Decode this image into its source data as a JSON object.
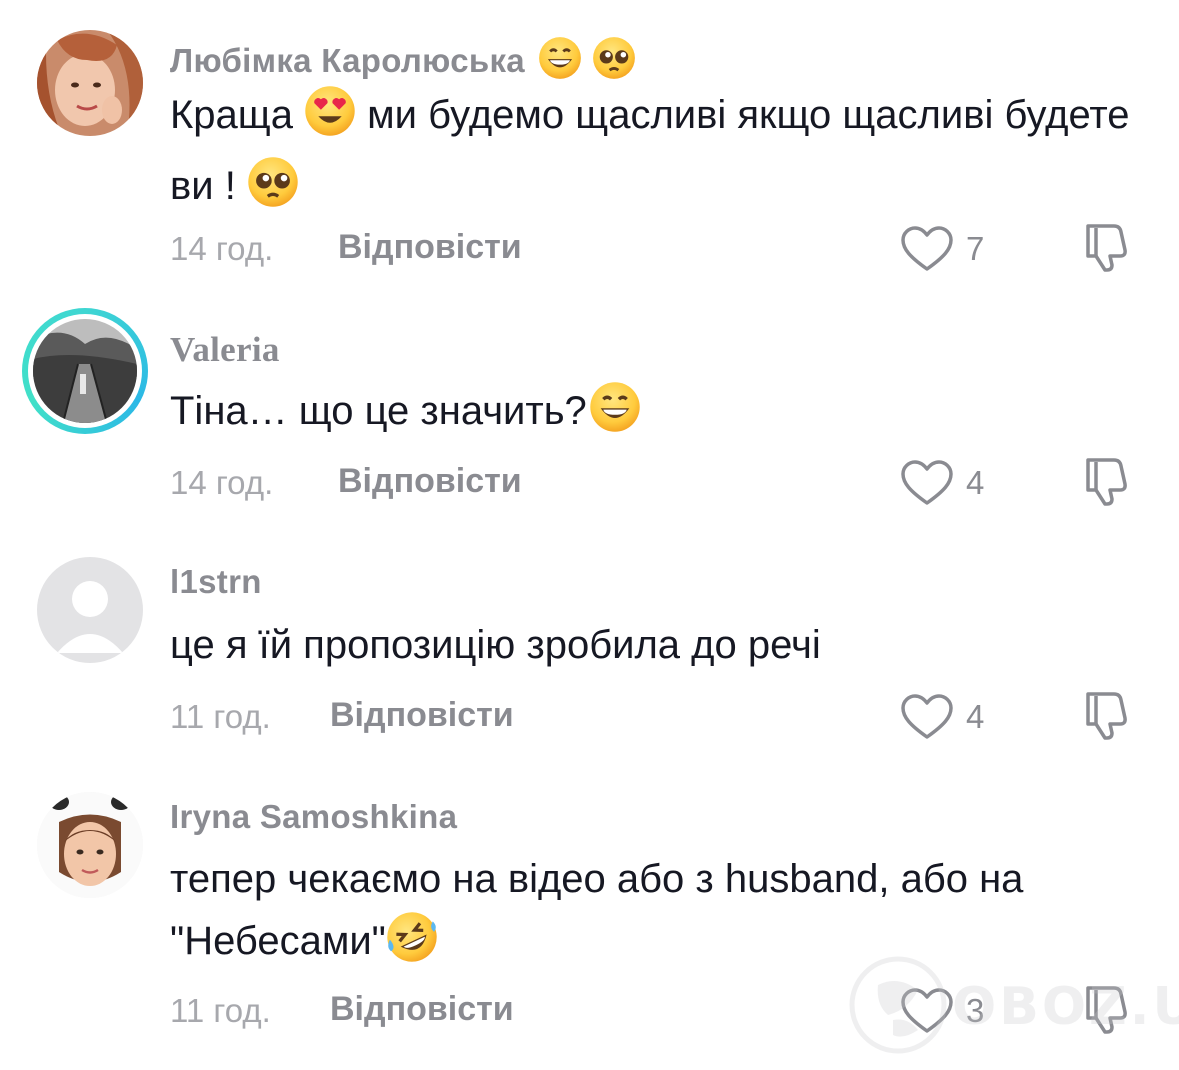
{
  "comments": [
    {
      "username": "Любімка Каролюська",
      "username_emojis": [
        "grinning-face",
        "pleading-face"
      ],
      "text_parts": [
        "Краща ",
        " ми будемо щасливі якщо щасливі будете ви ! "
      ],
      "emojis": [
        "heart-eyes-face",
        "pleading-face"
      ],
      "time": "14 год.",
      "reply": "Відповісти",
      "likes": "7"
    },
    {
      "username": "Valeria",
      "text_parts": [
        "Тіна… що це значить?"
      ],
      "emojis": [
        "grinning-face"
      ],
      "time": "14 год.",
      "reply": "Відповісти",
      "likes": "4"
    },
    {
      "username": "l1strn",
      "text_parts": [
        "це я їй пропозицію зробила до речі"
      ],
      "time": "11 год.",
      "reply": "Відповісти",
      "likes": "4"
    },
    {
      "username": "Iryna Samoshkina",
      "text_parts": [
        "тепер чекаємо на відео або з husband, або на \"Небесами\""
      ],
      "emojis": [
        "rolling-laughing-face"
      ],
      "time": "11 год.",
      "reply": "Відповісти",
      "likes": "3"
    }
  ],
  "watermark": "OBOZ.UA",
  "colors": {
    "text": "#161823",
    "muted": "#8a8b91",
    "light_muted": "#a7a8ad",
    "story_ring": "#3fd6d2"
  }
}
